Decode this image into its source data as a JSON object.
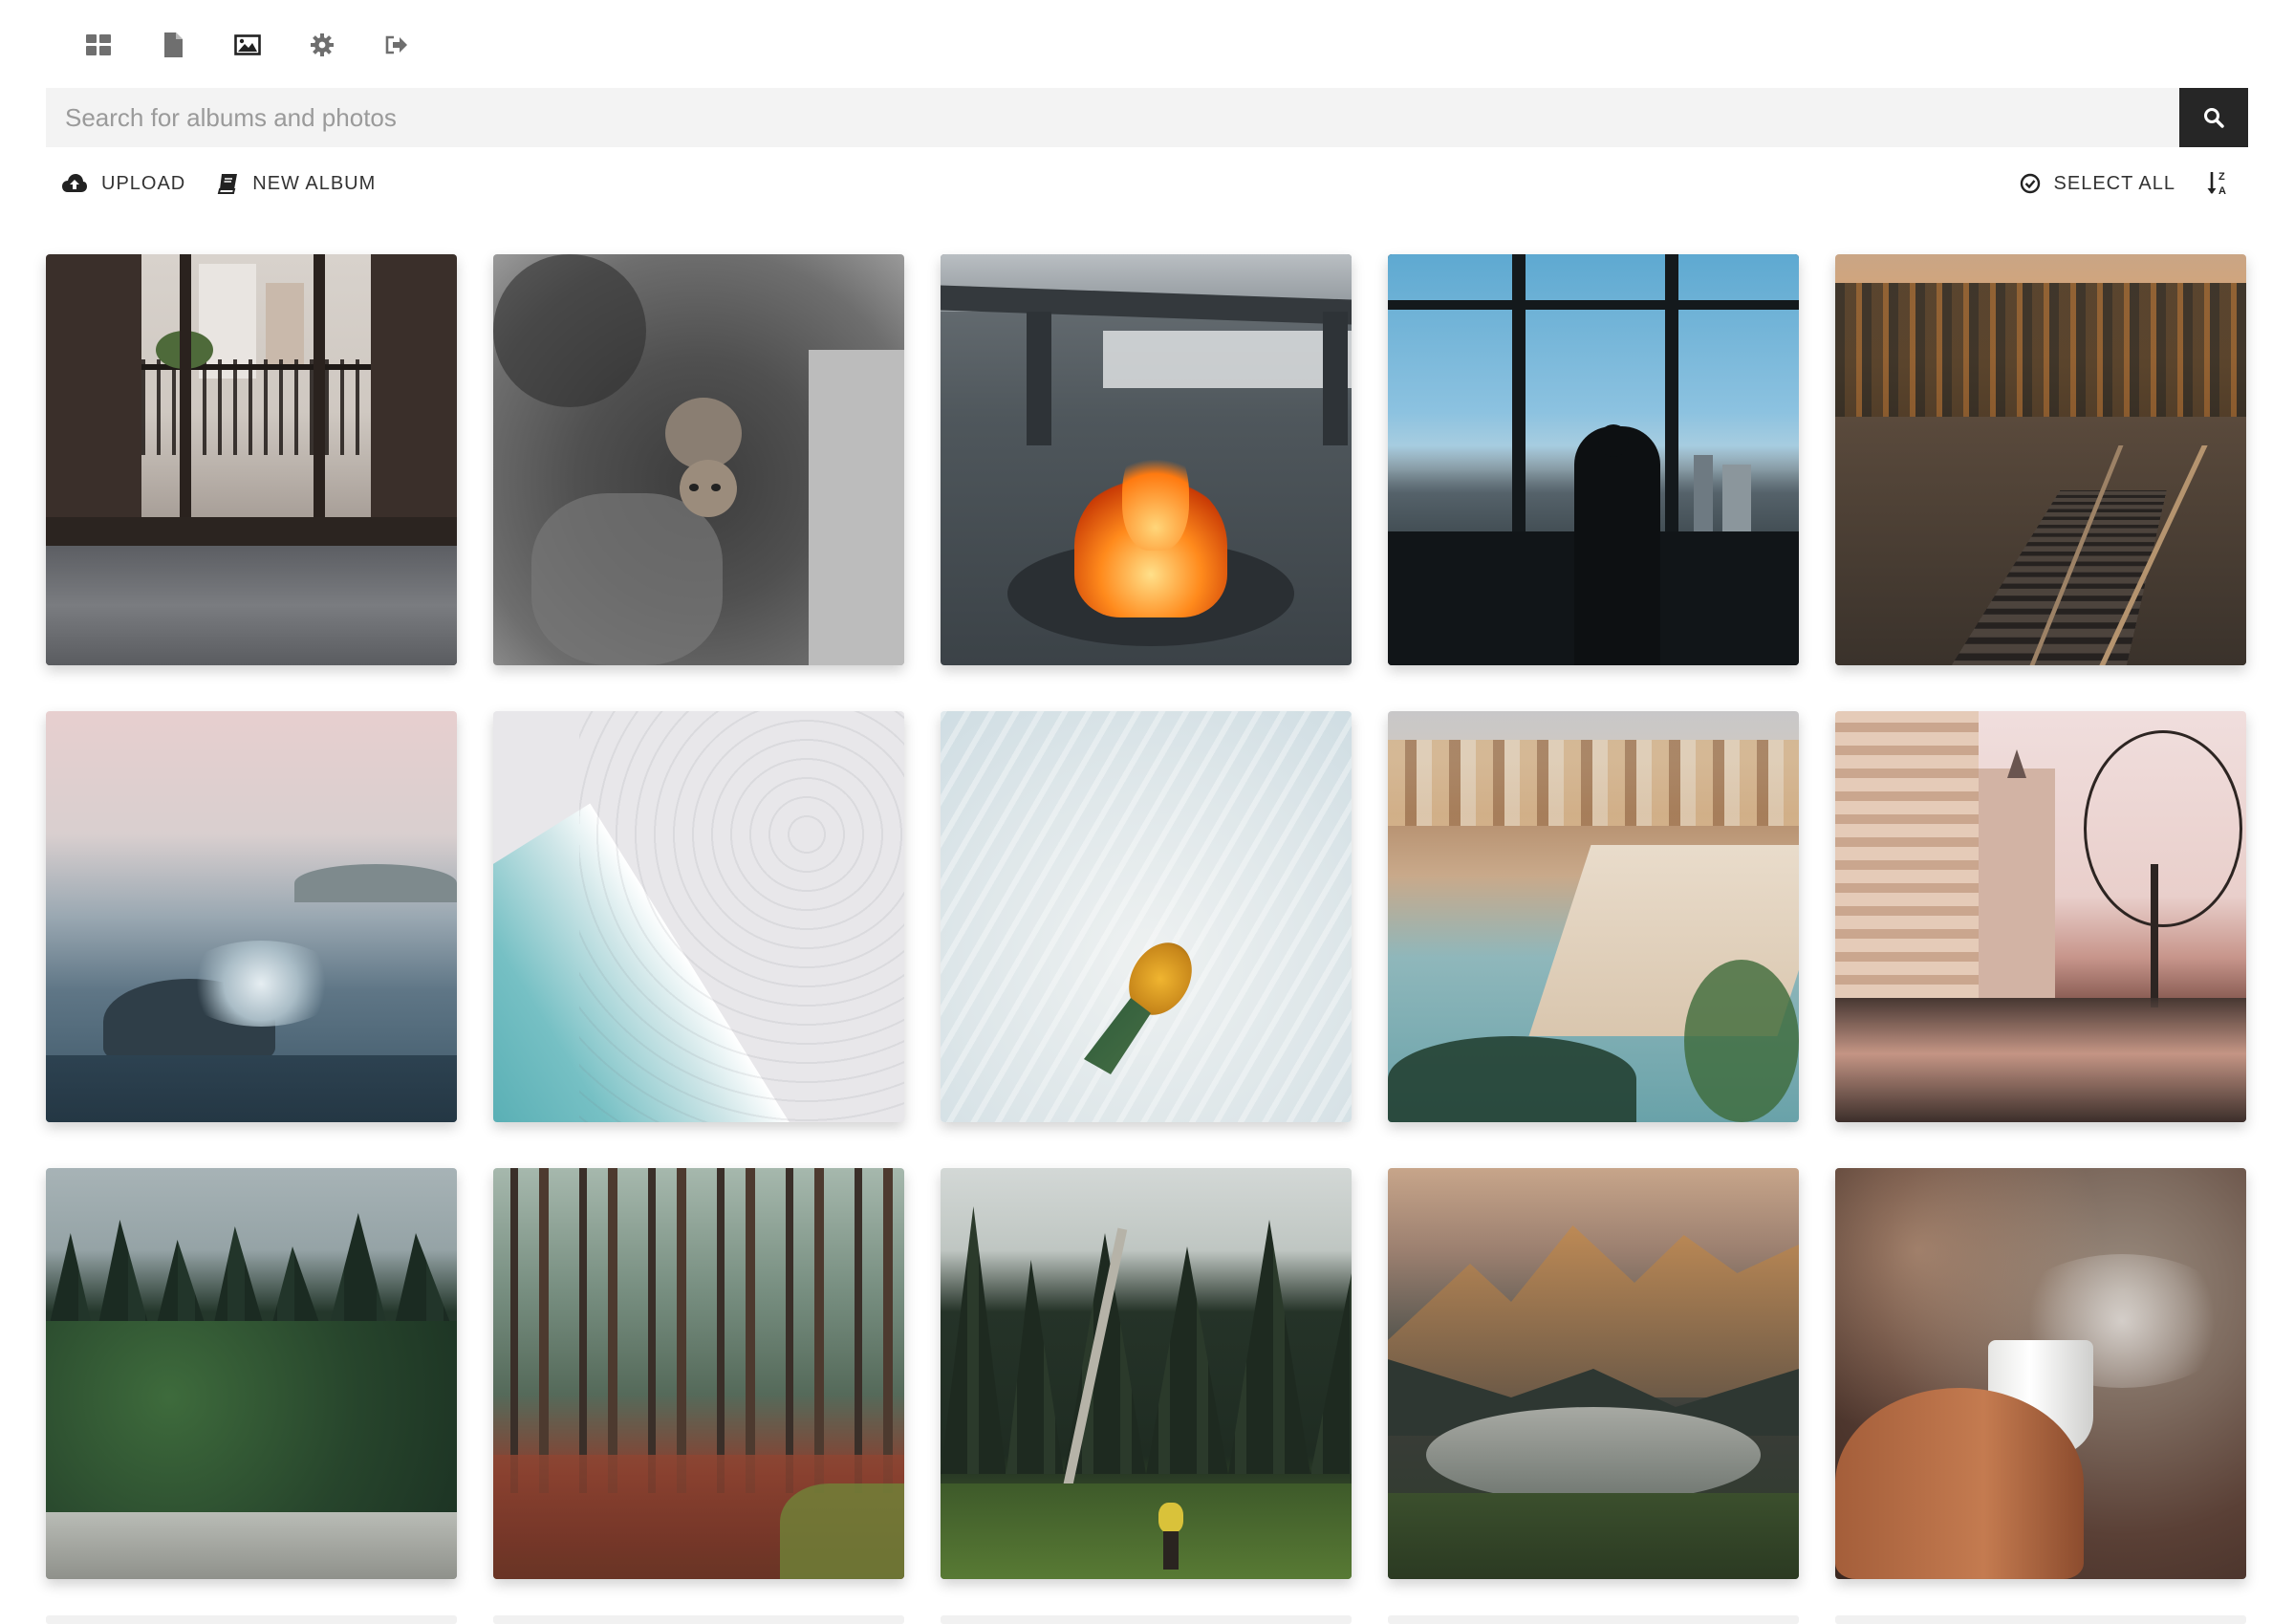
{
  "nav": {
    "items": [
      {
        "name": "dashboard-icon"
      },
      {
        "name": "file-icon"
      },
      {
        "name": "image-icon"
      },
      {
        "name": "gear-icon"
      },
      {
        "name": "logout-icon"
      }
    ]
  },
  "search": {
    "placeholder": "Search for albums and photos",
    "value": ""
  },
  "toolbar": {
    "upload_label": "UPLOAD",
    "new_album_label": "NEW ALBUM",
    "select_all_label": "SELECT ALL"
  },
  "colors": {
    "icon": "#6f6f6f",
    "search_bg": "#f3f3f3",
    "search_button": "#262626"
  },
  "photos": [
    {
      "subject": "open window with balcony over bed"
    },
    {
      "subject": "kitten on grey blanket"
    },
    {
      "subject": "campfire by a bench"
    },
    {
      "subject": "silhouette at window over city"
    },
    {
      "subject": "railway tracks through autumn forest"
    },
    {
      "subject": "ocean wave at sunset"
    },
    {
      "subject": "aerial beach shoreline"
    },
    {
      "subject": "pineapple in shallow water"
    },
    {
      "subject": "crowded city beach"
    },
    {
      "subject": "city street reflection with bare tree"
    },
    {
      "subject": "dense evergreen forest"
    },
    {
      "subject": "pine forest with red ground"
    },
    {
      "subject": "hiker in forest"
    },
    {
      "subject": "mountain lake at sunset"
    },
    {
      "subject": "hand holding steaming cup"
    }
  ]
}
